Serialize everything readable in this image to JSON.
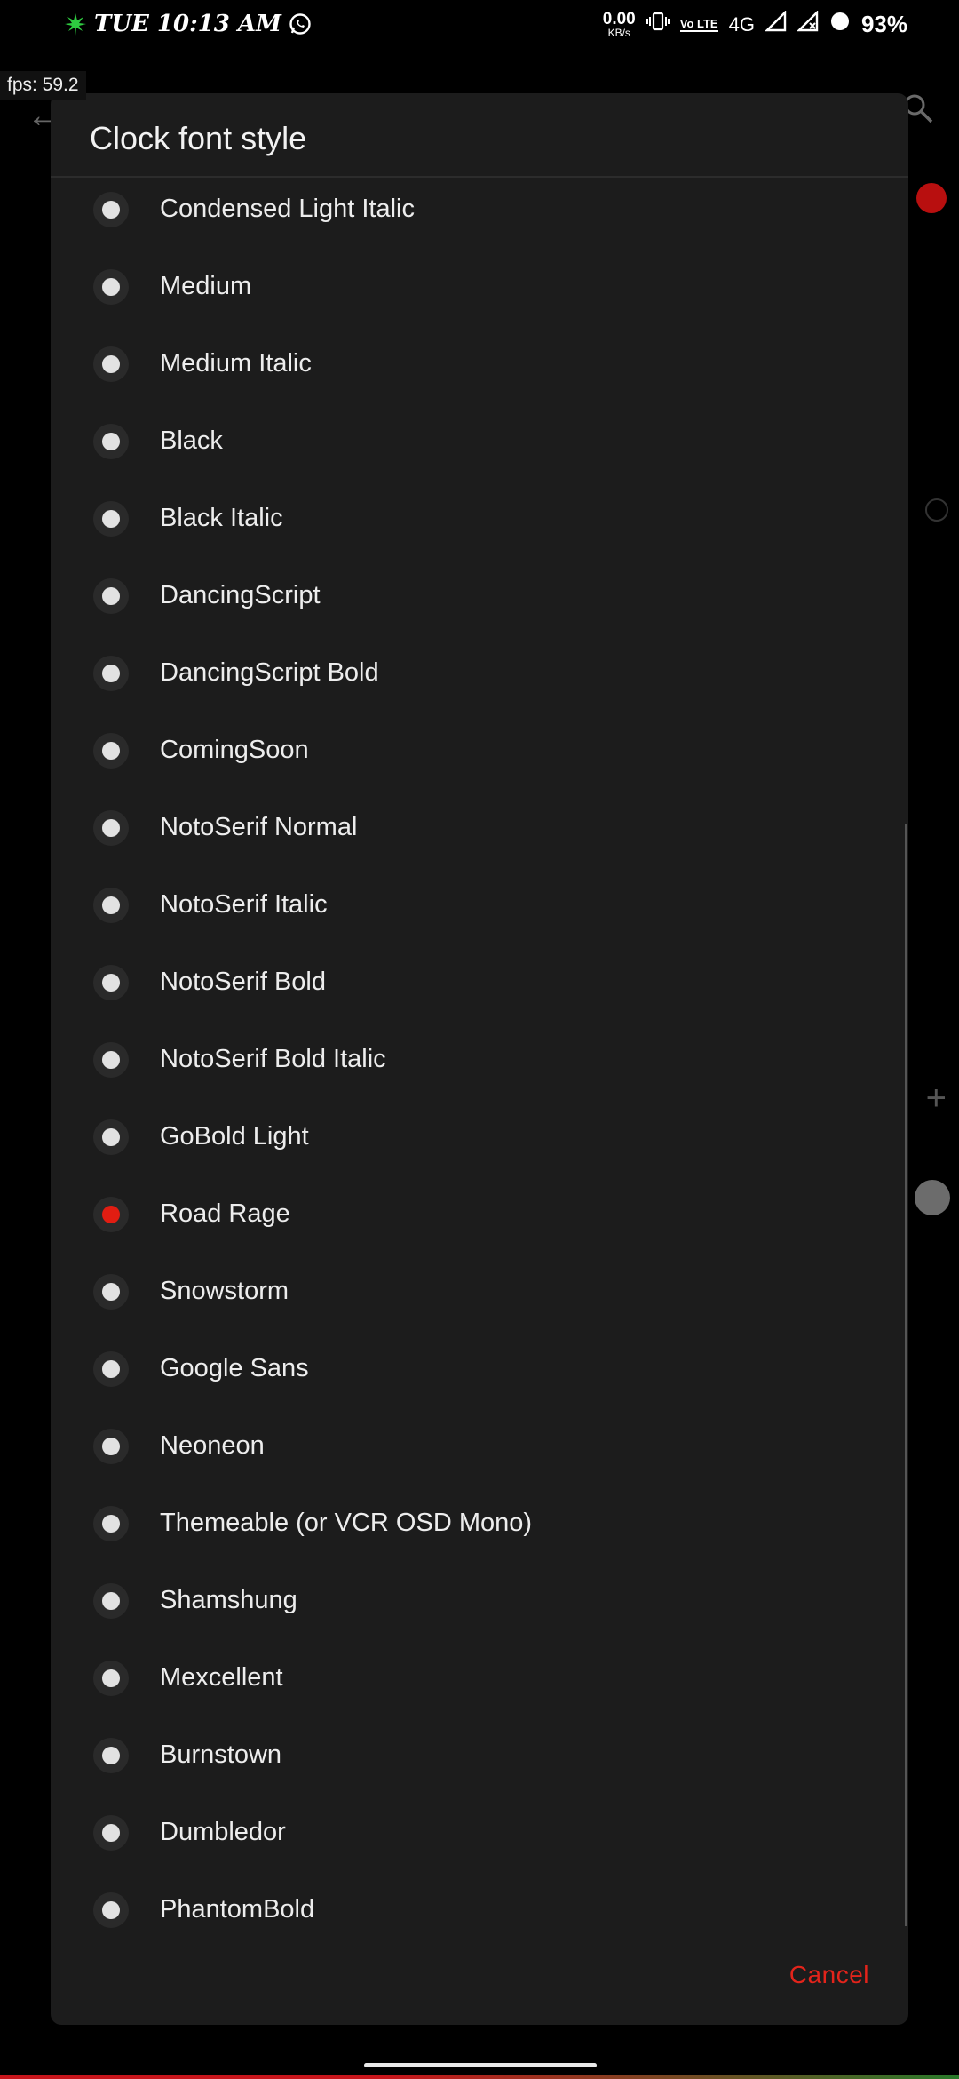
{
  "status_bar": {
    "time": "TUE 10:13 AM",
    "net_speed_value": "0.00",
    "net_speed_unit": "KB/s",
    "volte": "Vo LTE",
    "network": "4G",
    "battery_percent": "93%",
    "leaf_color": "#2ecc40"
  },
  "overlay": {
    "fps": "fps: 59.2"
  },
  "dialog": {
    "title": "Clock font style",
    "options": [
      {
        "label": "Condensed Light Italic",
        "selected": false
      },
      {
        "label": "Medium",
        "selected": false
      },
      {
        "label": "Medium Italic",
        "selected": false
      },
      {
        "label": "Black",
        "selected": false
      },
      {
        "label": "Black Italic",
        "selected": false
      },
      {
        "label": "DancingScript",
        "selected": false
      },
      {
        "label": "DancingScript Bold",
        "selected": false
      },
      {
        "label": "ComingSoon",
        "selected": false
      },
      {
        "label": "NotoSerif Normal",
        "selected": false
      },
      {
        "label": "NotoSerif Italic",
        "selected": false
      },
      {
        "label": "NotoSerif Bold",
        "selected": false
      },
      {
        "label": "NotoSerif Bold Italic",
        "selected": false
      },
      {
        "label": "GoBold Light",
        "selected": false
      },
      {
        "label": "Road Rage",
        "selected": true
      },
      {
        "label": "Snowstorm",
        "selected": false
      },
      {
        "label": "Google Sans",
        "selected": false
      },
      {
        "label": "Neoneon",
        "selected": false
      },
      {
        "label": "Themeable (or VCR OSD Mono)",
        "selected": false
      },
      {
        "label": "Shamshung",
        "selected": false
      },
      {
        "label": "Mexcellent",
        "selected": false
      },
      {
        "label": "Burnstown",
        "selected": false
      },
      {
        "label": "Dumbledor",
        "selected": false
      },
      {
        "label": "PhantomBold",
        "selected": false
      }
    ],
    "cancel_label": "Cancel",
    "accent_color": "#e3241b"
  }
}
